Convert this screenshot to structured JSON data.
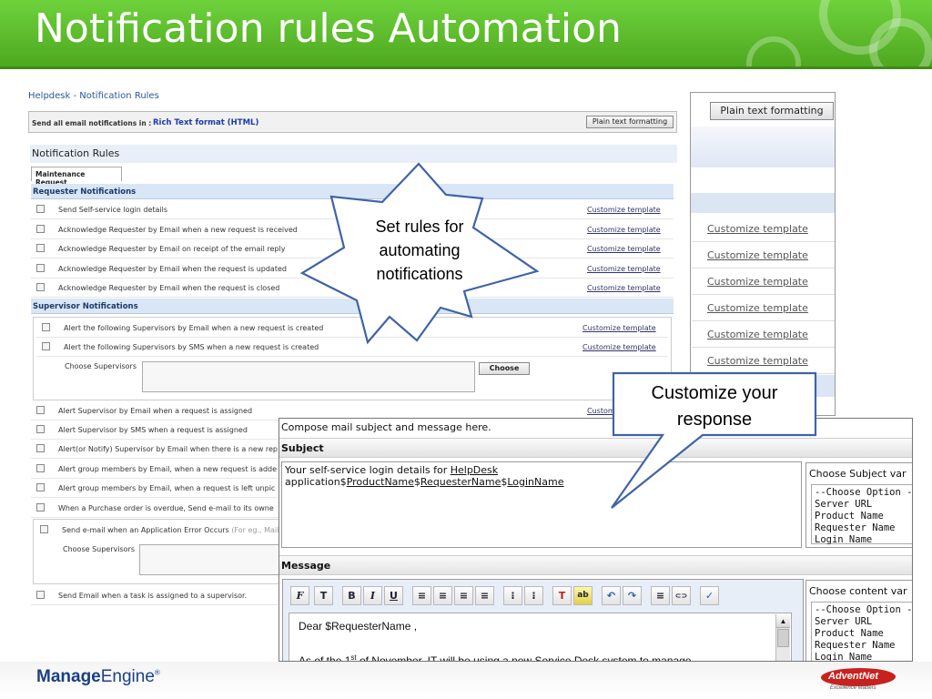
{
  "slide": {
    "title": "Notification rules Automation",
    "footer_brand_manage": "Manage",
    "footer_brand_engine": "Engine",
    "footer_brand_mark": "®",
    "footer_right_logo": "AdventNet",
    "footer_right_tagline": "Excellence Matters"
  },
  "helpdesk": {
    "breadcrumb": "Helpdesk - Notification Rules",
    "send_label": "Send all email notifications in :",
    "send_format": "Rich Text format (HTML)",
    "plain_button": "Plain text formatting",
    "section_title": "Notification Rules",
    "tab": "Maintenance Request",
    "requester_header": "Requester Notifications",
    "requester_rows": [
      {
        "text": "Send Self-service login details",
        "link": "Customize template"
      },
      {
        "text": "Acknowledge Requester by Email when a new request is received",
        "link": "Customize template"
      },
      {
        "text": "Acknowledge Requester by Email on receipt of the email reply",
        "link": "Customize template"
      },
      {
        "text": "Acknowledge Requester by Email when the request is updated",
        "link": "Customize template"
      },
      {
        "text": "Acknowledge Requester by Email when the request is closed",
        "link": "Customize template"
      }
    ],
    "supervisor_header": "Supervisor Notifications",
    "supervisor_rows": [
      {
        "text": "Alert the following Supervisors by Email when a new request is created",
        "link": "Customize template"
      },
      {
        "text": "Alert the following Supervisors by SMS when a new request is created",
        "link": "Customize template"
      }
    ],
    "choose_supervisors": "Choose Supervisors",
    "choose_button": "Choose",
    "more_rows": [
      {
        "text": "Alert Supervisor by Email when a request is assigned",
        "link": "Custom"
      },
      {
        "text": "Alert Supervisor by SMS when a request is assigned",
        "link": ""
      },
      {
        "text": "Alert(or Notify) Supervisor by Email when there is a new rep",
        "link": ""
      },
      {
        "text": "Alert group members by Email, when a new request is adde",
        "link": ""
      },
      {
        "text": "Alert group members by Email, when a request is left unpic",
        "link": ""
      },
      {
        "text": "When a Purchase order is overdue, Send e-mail to its owne",
        "link": ""
      }
    ],
    "app_error_text": "Send e-mail when an Application Error Occurs",
    "app_error_hint": "(For eg., Mail",
    "choose_supervisors_2": "Choose Supervisors",
    "task_row": "Send Email when a task is assigned to a supervisor."
  },
  "right_panel": {
    "plain_button": "Plain text formatting",
    "links": [
      "Customize template",
      "Customize template",
      "Customize template",
      "Customize template",
      "Customize template",
      "Customize template"
    ]
  },
  "compose": {
    "intro": "Compose mail subject and message here.",
    "subject_label": "Subject",
    "subject_value": "Your self-service login details for HelpDesk application$ProductName$RequesterName$LoginName",
    "subject_part1": "Your self-service login details for ",
    "subject_link1": "HelpDesk",
    "subject_part2": "application$",
    "subject_link2": "ProductName",
    "subject_part3": "$",
    "subject_link3": "RequesterName",
    "subject_part4": "$",
    "subject_link4": "LoginName",
    "subject_vars_label": "Choose Subject var",
    "subject_vars": [
      "--Choose Option -",
      "Server URL",
      "Product Name",
      "Requester Name",
      "Login Name"
    ],
    "message_label": "Message",
    "toolbar": [
      "F",
      "T",
      "B",
      "I",
      "U",
      "≡",
      "≡",
      "≡",
      "≡",
      "⁝",
      "⁝",
      "T",
      "ab",
      "↶",
      "↷",
      "≡",
      "⊂⊃",
      "✓"
    ],
    "body_greeting": "Dear $RequesterName ,",
    "body_line2_a": "As of the 1",
    "body_line2_sup": "st",
    "body_line2_b": " of November, IT will be using a new Service Desk system to manage",
    "content_vars_label": "Choose content var",
    "content_vars": [
      "--Choose Option -",
      "Server URL",
      "Product Name",
      "Requester Name",
      "Login Name"
    ]
  },
  "callouts": {
    "star": "Set rules for automating notifications",
    "star_lines": [
      "Set rules for",
      "automating",
      "notifications"
    ],
    "speech": "Customize your response",
    "speech_lines": [
      "Customize your",
      "response"
    ]
  }
}
